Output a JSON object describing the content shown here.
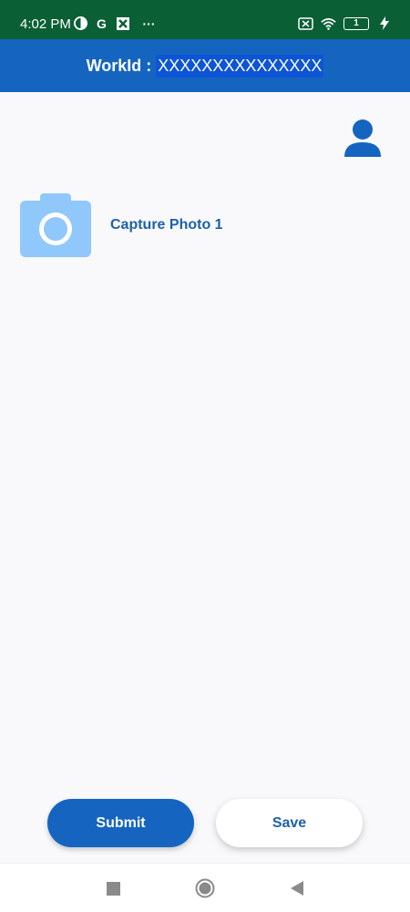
{
  "status_bar": {
    "time": "4:02 PM",
    "left_icons": [
      "pie-icon",
      "google-icon",
      "app-icon",
      "more-dots-icon"
    ],
    "more_dots": "···",
    "google_letter": "G",
    "right_icons": [
      "sim-off-icon",
      "wifi-icon",
      "battery-icon",
      "charging-icon"
    ],
    "battery_level": "1"
  },
  "header": {
    "label": "WorkId :",
    "value": "XXXXXXXXXXXXXXX",
    "bg_color": "#1565c0"
  },
  "profile": {
    "icon": "user-icon"
  },
  "capture": {
    "icon": "camera-icon",
    "label": "Capture Photo 1"
  },
  "actions": {
    "submit_label": "Submit",
    "save_label": "Save"
  },
  "nav": {
    "icons": [
      "recents-square-icon",
      "home-circle-icon",
      "back-triangle-icon"
    ]
  }
}
